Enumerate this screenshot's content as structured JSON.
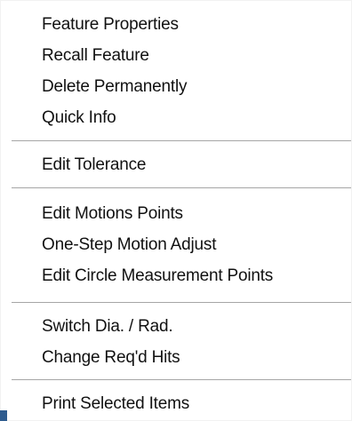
{
  "context_menu": {
    "items": [
      {
        "label": "Feature Properties"
      },
      {
        "label": "Recall Feature"
      },
      {
        "label": "Delete Permanently"
      },
      {
        "label": "Quick Info"
      },
      {
        "label": "Edit Tolerance"
      },
      {
        "label": "Edit Motions Points"
      },
      {
        "label": "One-Step Motion Adjust"
      },
      {
        "label": "Edit Circle Measurement Points"
      },
      {
        "label": "Switch Dia. / Rad."
      },
      {
        "label": "Change Req'd Hits"
      },
      {
        "label": "Print Selected Items"
      }
    ]
  }
}
